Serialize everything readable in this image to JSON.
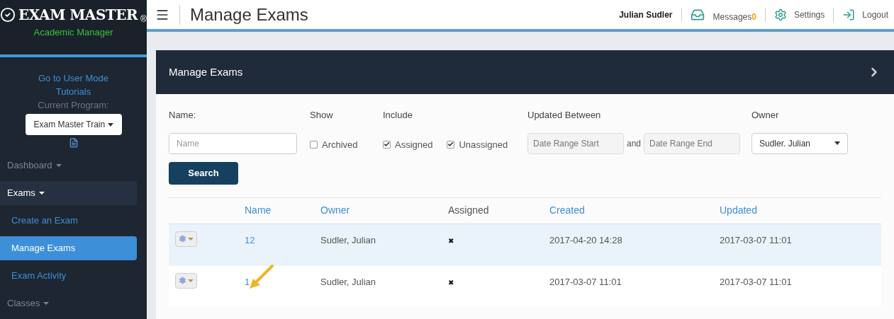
{
  "logo": {
    "title": "EXAM MASTER",
    "mark": "®",
    "subtitle": "Academic Manager"
  },
  "sidebar": {
    "links": [
      "Go to User Mode",
      "Tutorials"
    ],
    "program_label": "Current Program:",
    "program": "Exam Master Train",
    "items": [
      {
        "label": "Dashboard",
        "kind": "section",
        "expanded": false,
        "selected": false
      },
      {
        "label": "Exams",
        "kind": "section",
        "expanded": true,
        "selected": false
      },
      {
        "label": "Create an Exam",
        "kind": "subitem",
        "selected": false
      },
      {
        "label": "Manage Exams",
        "kind": "subitem",
        "selected": true
      },
      {
        "label": "Exam Activity",
        "kind": "subitem",
        "selected": false
      },
      {
        "label": "Classes",
        "kind": "section",
        "expanded": false,
        "selected": false
      }
    ]
  },
  "header": {
    "title": "Manage Exams",
    "user": "Julian Sudler",
    "messages": "Messages",
    "message_count": "0",
    "settings": "Settings",
    "logout": "Logout"
  },
  "panel": {
    "title": "Manage Exams"
  },
  "filters": {
    "name_label": "Name:",
    "name_placeholder": "Name",
    "show_label": "Show",
    "show_options": [
      {
        "label": "Archived",
        "checked": false
      }
    ],
    "include_label": "Include",
    "include_options": [
      {
        "label": "Assigned",
        "checked": true
      },
      {
        "label": "Unassigned",
        "checked": true
      }
    ],
    "updated_label": "Updated Between",
    "start_placeholder": "Date Range Start",
    "and": "and",
    "end_placeholder": "Date Range End",
    "owner_label": "Owner",
    "owner": "Sudler. Julian",
    "search": "Search"
  },
  "table": {
    "columns": [
      {
        "label": "Name",
        "sortable": true
      },
      {
        "label": "Owner",
        "sortable": true
      },
      {
        "label": "Assigned",
        "sortable": false
      },
      {
        "label": "Created",
        "sortable": true
      },
      {
        "label": "Updated",
        "sortable": true
      }
    ],
    "rows": [
      {
        "selected": true,
        "cells": [
          "12",
          "Sudler, Julian",
          "✖",
          "2017-04-20 14:28",
          "2017-03-07 11:01"
        ]
      },
      {
        "selected": false,
        "cells": [
          "1",
          "Sudler, Julian",
          "✖",
          "2017-03-07 11:01",
          "2017-03-07 11:01"
        ]
      }
    ]
  }
}
